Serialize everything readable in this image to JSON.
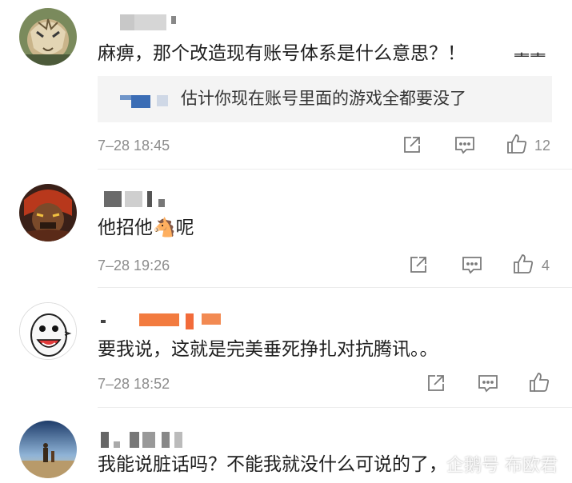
{
  "comments": [
    {
      "text": "麻痹，那个改造现有账号体系是什么意思？！",
      "reply_text": "估计你现在账号里面的游戏全都要没了",
      "time": "7–28 18:45",
      "likes": "12",
      "action_icons": [
        "share-icon",
        "comment-icon",
        "like-icon"
      ]
    },
    {
      "text": "他招他🐴呢",
      "time": "7–28 19:26",
      "likes": "4",
      "action_icons": [
        "share-icon",
        "comment-icon",
        "like-icon"
      ]
    },
    {
      "text": "要我说，这就是完美垂死挣扎对抗腾讯。。",
      "time": "7–28 18:52",
      "likes": "",
      "action_icons": [
        "share-icon",
        "comment-icon",
        "like-icon"
      ]
    },
    {
      "text": "我能说脏话吗？不能我就没什么可说的了，",
      "time": "",
      "likes": ""
    }
  ],
  "watermark": "企鹅号 布欧君",
  "colors": {
    "text": "#1e1e1e",
    "meta": "#8c8c8c",
    "reply_bg": "#f4f4f4",
    "divider": "#ececec"
  }
}
